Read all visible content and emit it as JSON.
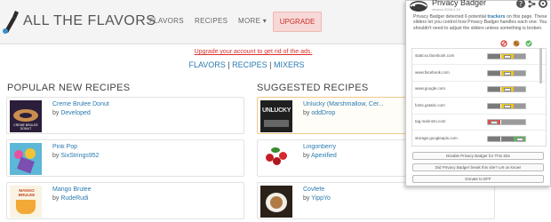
{
  "header": {
    "brand": "ALL THE FLAVORS",
    "nav": [
      "FLAVORS",
      "RECIPES",
      "MORE ▾"
    ],
    "upgrade_label": "UPGRADE"
  },
  "banner": {
    "upgrade_message": "Upgrade your account to get rid of the ads.",
    "links": [
      "FLAVORS",
      "RECIPES",
      "MIXERS"
    ],
    "separator": " | "
  },
  "popular": {
    "title": "POPULAR NEW RECIPES",
    "items": [
      {
        "title": "Creme Brulee Donut",
        "by": "by",
        "author": "Developed",
        "thumb": "CREME BRULEE DONUT"
      },
      {
        "title": "Pink Pop",
        "by": "by",
        "author": "SixStrings952",
        "thumb": ""
      },
      {
        "title": "Mango Brulee",
        "by": "by",
        "author": "RudeRudi",
        "thumb": "MANGO BRULEE"
      }
    ]
  },
  "suggested": {
    "title": "SUGGESTED RECIPES",
    "items": [
      {
        "title": "Unlucky (Marshmallow, Cer...",
        "by": "by",
        "author": "oddDrop",
        "thumb": "UNLUCKY"
      },
      {
        "title": "Lingonberry",
        "by": "by",
        "author": "Apexified",
        "thumb": ""
      },
      {
        "title": "Covfefe",
        "by": "by",
        "author": "YippYo",
        "thumb": ""
      }
    ]
  },
  "privacy_badger": {
    "title": "Privacy Badger",
    "version": "version 2018.2.19",
    "desc_before": "Privacy Badger detected 6 potential ",
    "desc_link": "trackers",
    "desc_after": " on this page. These sliders let you control how Privacy Badger handles each one. You shouldn't need to adjust the sliders unless something is broken.",
    "domains": [
      {
        "name": "staticxx.facebook.com",
        "state": "yellow"
      },
      {
        "name": "www.facebook.com",
        "state": "yellow"
      },
      {
        "name": "www.google.com",
        "state": "yellow"
      },
      {
        "name": "fonts.gstatic.com",
        "state": "yellow"
      },
      {
        "name": "tag.marinsm.com",
        "state": "red"
      },
      {
        "name": "storage.googleapis.com",
        "state": "green"
      }
    ],
    "buttons": [
      "Disable Privacy Badger for This Site",
      "Did Privacy Badger break this site? Let us know!",
      "Donate to EFF"
    ],
    "colors": {
      "red": "#d9534f",
      "yellow": "#f0c419",
      "green": "#5cb85c"
    }
  }
}
